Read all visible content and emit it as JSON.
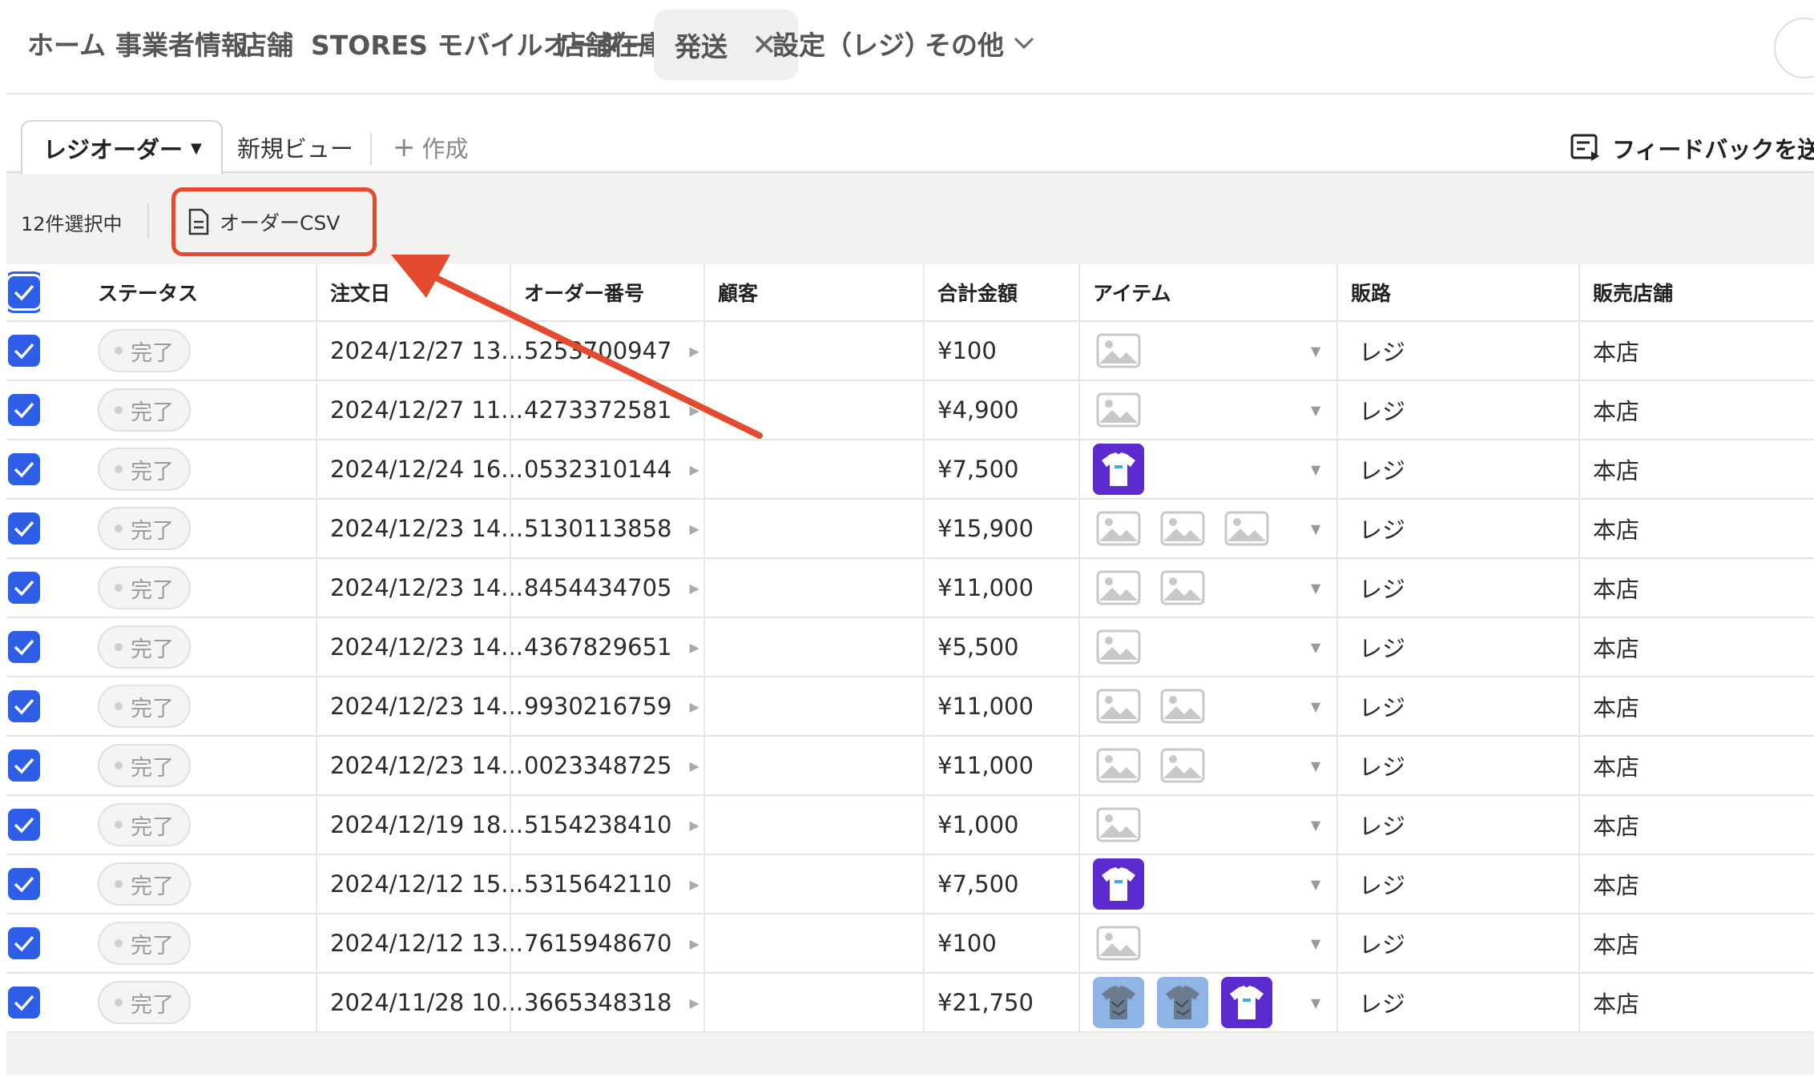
{
  "nav": {
    "items": [
      "ホーム",
      "事業者情報",
      "店舗",
      "STORES モバイルオーダー",
      "店舗在庫"
    ],
    "active": "発送",
    "settings": "設定（レジ）",
    "more": "その他"
  },
  "views": {
    "active": "レジオーダー",
    "other": "新規ビュー",
    "create": "作成",
    "feedback": "フィードバックを送"
  },
  "selection": {
    "count_label": "12件選択中",
    "csv_button": "オーダーCSV"
  },
  "table": {
    "columns": [
      "ステータス",
      "注文日",
      "オーダー番号",
      "顧客",
      "合計金額",
      "アイテム",
      "販路",
      "販売店舗"
    ],
    "rows": [
      {
        "status": "完了",
        "date": "2024/12/27 13...",
        "order": "5253700947",
        "customer": "",
        "total": "¥100",
        "items": [
          "placeholder"
        ],
        "channel": "レジ",
        "store": "本店"
      },
      {
        "status": "完了",
        "date": "2024/12/27 11...",
        "order": "4273372581",
        "customer": "",
        "total": "¥4,900",
        "items": [
          "placeholder"
        ],
        "channel": "レジ",
        "store": "本店"
      },
      {
        "status": "完了",
        "date": "2024/12/24 16...",
        "order": "0532310144",
        "customer": "",
        "total": "¥7,500",
        "items": [
          "tshirt"
        ],
        "channel": "レジ",
        "store": "本店"
      },
      {
        "status": "完了",
        "date": "2024/12/23 14...",
        "order": "5130113858",
        "customer": "",
        "total": "¥15,900",
        "items": [
          "placeholder",
          "placeholder",
          "placeholder"
        ],
        "channel": "レジ",
        "store": "本店"
      },
      {
        "status": "完了",
        "date": "2024/12/23 14...",
        "order": "8454434705",
        "customer": "",
        "total": "¥11,000",
        "items": [
          "placeholder",
          "placeholder"
        ],
        "channel": "レジ",
        "store": "本店"
      },
      {
        "status": "完了",
        "date": "2024/12/23 14...",
        "order": "4367829651",
        "customer": "",
        "total": "¥5,500",
        "items": [
          "placeholder"
        ],
        "channel": "レジ",
        "store": "本店"
      },
      {
        "status": "完了",
        "date": "2024/12/23 14...",
        "order": "9930216759",
        "customer": "",
        "total": "¥11,000",
        "items": [
          "placeholder",
          "placeholder"
        ],
        "channel": "レジ",
        "store": "本店"
      },
      {
        "status": "完了",
        "date": "2024/12/23 14...",
        "order": "0023348725",
        "customer": "",
        "total": "¥11,000",
        "items": [
          "placeholder",
          "placeholder"
        ],
        "channel": "レジ",
        "store": "本店"
      },
      {
        "status": "完了",
        "date": "2024/12/19 18...",
        "order": "5154238410",
        "customer": "",
        "total": "¥1,000",
        "items": [
          "placeholder"
        ],
        "channel": "レジ",
        "store": "本店"
      },
      {
        "status": "完了",
        "date": "2024/12/12 15...",
        "order": "5315642110",
        "customer": "",
        "total": "¥7,500",
        "items": [
          "tshirt"
        ],
        "channel": "レジ",
        "store": "本店"
      },
      {
        "status": "完了",
        "date": "2024/12/12 13...",
        "order": "7615948670",
        "customer": "",
        "total": "¥100",
        "items": [
          "placeholder"
        ],
        "channel": "レジ",
        "store": "本店"
      },
      {
        "status": "完了",
        "date": "2024/11/28 10...",
        "order": "3665348318",
        "customer": "",
        "total": "¥21,750",
        "items": [
          "pattern",
          "pattern",
          "tshirt"
        ],
        "channel": "レジ",
        "store": "本店"
      }
    ]
  },
  "colors": {
    "accent": "#2e5ee8",
    "highlight": "#e34a2e",
    "tshirt_bg": "#5b2bd0"
  },
  "icons": {
    "close": "close-icon",
    "chevron": "chevron-down-icon",
    "document": "document-icon",
    "feedback": "feedback-icon",
    "check": "check-icon",
    "image_placeholder": "image-placeholder-icon"
  }
}
